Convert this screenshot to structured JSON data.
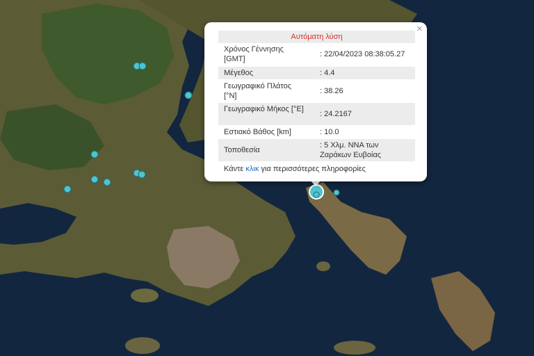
{
  "popup": {
    "close_label": "×",
    "title": "Αυτόματη λύση",
    "rows": [
      {
        "label": "Χρόνος Γέννησης [GMT]",
        "value": ": 22/04/2023 08:38:05.27"
      },
      {
        "label": "Μέγεθος",
        "value": ": 4.4"
      },
      {
        "label": "Γεωγραφικό Πλάτος [°N]",
        "value": ": 38.26"
      },
      {
        "label": "Γεωγραφικό Μήκος [°E]",
        "value": ": 24.2167"
      },
      {
        "label": "Εστιακό Βάθος [km]",
        "value": ": 10.0"
      },
      {
        "label": "Τοποθεσία",
        "value": ": 5 Χλμ. ΝΝΑ των Ζαράκων Ευβοίας"
      }
    ],
    "more_prefix": "Κάντε ",
    "more_link": "κλικ",
    "more_suffix": " για περισσότερες πληροφορίες"
  },
  "colors": {
    "sea": "#13263f",
    "land": "#5a5a35",
    "marker": "#4fc3d0",
    "title_red": "#d62e2e",
    "link_blue": "#1a6bbf"
  }
}
